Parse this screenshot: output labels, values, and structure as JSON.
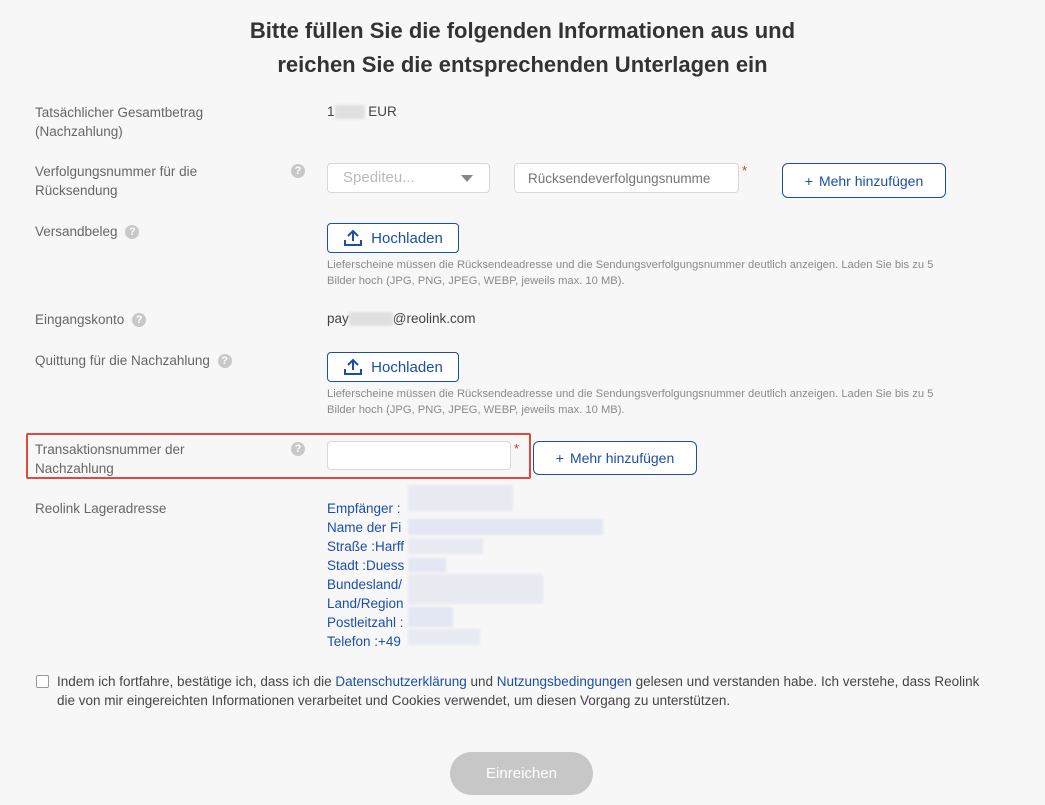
{
  "title": {
    "line1": "Bitte füllen Sie die folgenden Informationen aus und",
    "line2": "reichen Sie die entsprechenden Unterlagen ein"
  },
  "fields": {
    "total_amount": {
      "label_line1": "Tatsächlicher Gesamtbetrag",
      "label_line2": "(Nachzahlung)",
      "value_prefix": "1",
      "value_currency": "EUR"
    },
    "return_tracking": {
      "label_line1": "Verfolgungsnummer für die",
      "label_line2": "Rücksendung",
      "carrier_placeholder": "Spediteu...",
      "tracking_placeholder": "Rücksendeverfolgungsnumme",
      "add_more_label": "Mehr hinzufügen"
    },
    "shipping_receipt": {
      "label": "Versandbeleg",
      "upload_label": "Hochladen",
      "note_line1": "Lieferscheine müssen die Rücksendeadresse und die Sendungsverfolgungsnummer deutlich anzeigen. Laden Sie bis zu 5",
      "note_line2": "Bilder hoch (JPG, PNG, JPEG, WEBP, jeweils max. 10 MB)."
    },
    "receiving_account": {
      "label": "Eingangskonto",
      "value_prefix": "pay",
      "value_suffix": "@reolink.com"
    },
    "payment_receipt": {
      "label": "Quittung für die Nachzahlung",
      "upload_label": "Hochladen",
      "note_line1": "Lieferscheine müssen die Rücksendeadresse und die Sendungsverfolgungsnummer deutlich anzeigen. Laden Sie bis zu 5",
      "note_line2": "Bilder hoch (JPG, PNG, JPEG, WEBP, jeweils max. 10 MB)."
    },
    "transaction_number": {
      "label_line1": "Transaktionsnummer der",
      "label_line2": "Nachzahlung",
      "value": "",
      "add_more_label": "Mehr hinzufügen"
    },
    "warehouse_address": {
      "label": "Reolink Lageradresse",
      "lines": [
        "Empfänger :",
        "Name der Fi",
        "Straße :Harff",
        "Stadt :Duess",
        "Bundesland/",
        "Land/Region",
        "Postleitzahl :",
        "Telefon :+49"
      ]
    }
  },
  "required_mark": "*",
  "plus_symbol": "+",
  "help_symbol": "?",
  "consent": {
    "text_before": "Indem ich fortfahre, bestätige ich, dass ich die ",
    "privacy_link": "Datenschutzerklärung",
    "text_middle": " und ",
    "terms_link": "Nutzungsbedingungen",
    "text_after": " gelesen und verstanden habe. Ich verstehe, dass Reolink die von mir eingereichten Informationen verarbeitet und Cookies verwendet, um diesen Vorgang zu unterstützen."
  },
  "submit_label": "Einreichen",
  "colors": {
    "accent": "#1d4ea7",
    "highlight": "#e5473e",
    "required": "#d93025",
    "submit_disabled": "#c7c7c7"
  }
}
